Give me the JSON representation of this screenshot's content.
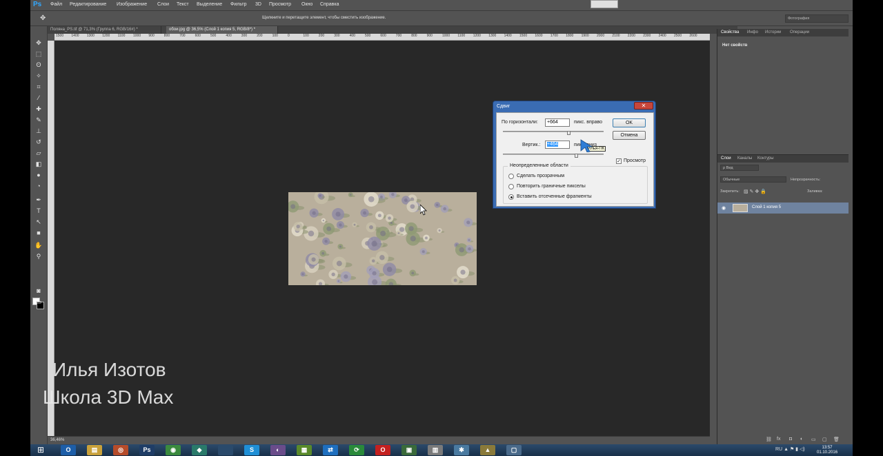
{
  "app": {
    "logo": "Ps"
  },
  "menu": [
    "Файл",
    "Редактирование",
    "Изображение",
    "Слои",
    "Текст",
    "Выделение",
    "Фильтр",
    "3D",
    "Просмотр",
    "Окно",
    "Справка"
  ],
  "options_bar": {
    "hint": "Щелкните и перетащите элемент, чтобы сместить изображение.",
    "workspace": "Фотография"
  },
  "tabs": [
    {
      "label": "Поляна_PS.tif @ 71,3% (Группа 6, RGB/16#) *",
      "active": false
    },
    {
      "label": "обои.jpg @ 36,5% (Слой 1 копия 5, RGB/8*) *",
      "active": true
    }
  ],
  "ruler": [
    "1500",
    "1400",
    "1300",
    "1200",
    "1100",
    "1000",
    "900",
    "800",
    "700",
    "600",
    "500",
    "400",
    "300",
    "200",
    "100",
    "0",
    "100",
    "200",
    "300",
    "400",
    "500",
    "600",
    "700",
    "800",
    "900",
    "1000",
    "1100",
    "1200",
    "1300",
    "1400",
    "1500",
    "1600",
    "1700",
    "1800",
    "1900",
    "2000",
    "2100",
    "2200",
    "2300",
    "2400",
    "2500",
    "2600"
  ],
  "status": {
    "zoom": "36,46%"
  },
  "dialog": {
    "title": "Сдвиг",
    "horizontal_label": "По горизонтали:",
    "horizontal_value": "+664",
    "horizontal_unit": "пикс. вправо",
    "horizontal_slider_fraction": 0.66,
    "vertical_label": "Вертик.:",
    "vertical_value": "+464",
    "vertical_unit": "пикс. вниз",
    "vertical_slider_fraction": 0.73,
    "tooltip": "Илья-ПК",
    "ok": "OK",
    "cancel": "Отмена",
    "preview_label": "Просмотр",
    "preview_checked": true,
    "undefined_group": "Неопределенные области",
    "options": [
      {
        "label": "Сделать прозрачным",
        "selected": false
      },
      {
        "label": "Повторить граничные пикселы",
        "selected": false
      },
      {
        "label": "Вставить отсеченные фрагменты",
        "selected": true
      }
    ]
  },
  "panels": {
    "top_tabs": [
      "Свойства",
      "Инфо",
      "Истории",
      "Операции"
    ],
    "no_properties": "Нет свойств",
    "layer_tabs": [
      "Слои",
      "Каналы",
      "Контуры"
    ],
    "filter_label": "Вид",
    "blend_mode": "Обычные",
    "opacity_label": "Непрозрачность:",
    "lock_label": "Закрепить:",
    "fill_label": "Заливка:",
    "layer_name": "Слой 1 копия 5"
  },
  "watermark": {
    "line1": "Илья Изотов",
    "line2": "Школа 3D Max"
  },
  "taskbar": {
    "icons": [
      {
        "name": "outlook",
        "glyph": "O",
        "color": "#1d5ea8"
      },
      {
        "name": "explorer",
        "glyph": "▤",
        "color": "#c9a13a"
      },
      {
        "name": "chrome-alt",
        "glyph": "◎",
        "color": "#b64c2a"
      },
      {
        "name": "photoshop",
        "glyph": "Ps",
        "color": "#1f3d66"
      },
      {
        "name": "chrome",
        "glyph": "◉",
        "color": "#3b8a3e"
      },
      {
        "name": "app-green",
        "glyph": "◆",
        "color": "#2a7a6a"
      },
      {
        "name": "blank",
        "glyph": "",
        "color": "#2a4a6b"
      },
      {
        "name": "skype",
        "glyph": "S",
        "color": "#1f8fd6"
      },
      {
        "name": "media",
        "glyph": "◐",
        "color": "#6a4c8a"
      },
      {
        "name": "books",
        "glyph": "▦",
        "color": "#5a8a2a"
      },
      {
        "name": "teamviewer",
        "glyph": "⇄",
        "color": "#1e6fbf"
      },
      {
        "name": "sync",
        "glyph": "⟳",
        "color": "#2a8a3a"
      },
      {
        "name": "opera",
        "glyph": "O",
        "color": "#c4201f"
      },
      {
        "name": "monitor",
        "glyph": "▣",
        "color": "#3a6a3a"
      },
      {
        "name": "doc",
        "glyph": "▥",
        "color": "#7a7a7a"
      },
      {
        "name": "tools",
        "glyph": "✱",
        "color": "#4a7aa0"
      },
      {
        "name": "archicad",
        "glyph": "▲",
        "color": "#8a7a3a"
      },
      {
        "name": "window",
        "glyph": "▢",
        "color": "#4a6a8a"
      }
    ],
    "time": "13:57",
    "date": "01.10.2016",
    "lang": "RU"
  }
}
